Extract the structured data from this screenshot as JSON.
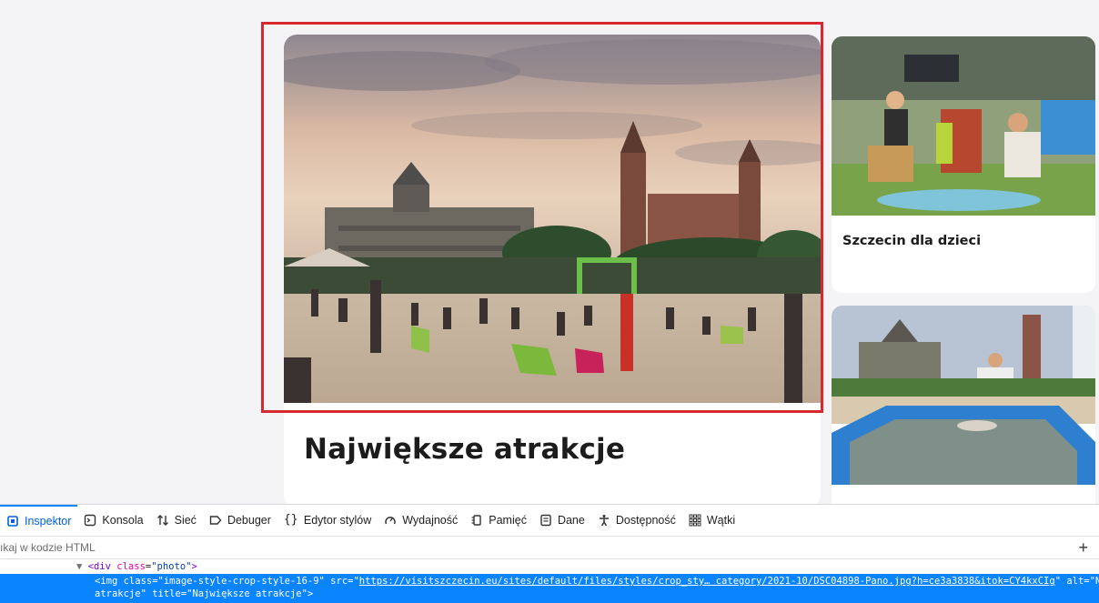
{
  "main_card": {
    "title": "Największe atrakcje",
    "photo_alt": "Największe atrakcje"
  },
  "side_cards": [
    {
      "title": "Szczecin dla dzieci"
    },
    {
      "title": ""
    }
  ],
  "devtools": {
    "tabs": [
      {
        "label": "Inspektor",
        "icon": "inspector-icon",
        "active": true
      },
      {
        "label": "Konsola",
        "icon": "console-icon"
      },
      {
        "label": "Sieć",
        "icon": "network-icon"
      },
      {
        "label": "Debuger",
        "icon": "debugger-icon"
      },
      {
        "label": "Edytor stylów",
        "icon": "style-editor-icon"
      },
      {
        "label": "Wydajność",
        "icon": "performance-icon"
      },
      {
        "label": "Pamięć",
        "icon": "memory-icon"
      },
      {
        "label": "Dane",
        "icon": "storage-icon"
      },
      {
        "label": "Dostępność",
        "icon": "accessibility-icon"
      },
      {
        "label": "Wątki",
        "icon": "threads-icon"
      }
    ],
    "search_placeholder": "ıkaj w kodzie HTML",
    "add_button": "+",
    "tree": {
      "open_tag": "<div",
      "attr_name": "class",
      "attr_value": "\"photo\"",
      "close": ">",
      "arrow": "▼",
      "img_line1_a": "<img class=\"image-style-crop-style-16-9\" src=\"",
      "img_url": "https://visitszczecin.eu/sites/default/files/styles/crop_sty… category/2021-10/DSC04898-Pano.jpg?h=ce3a3838&itok=CY4kxCIg",
      "img_line1_b": "\" alt=\"Największe",
      "img_line2": "atrakcje\" title=\"Największe atrakcje\">"
    }
  },
  "colors": {
    "highlight": "#d7282f",
    "devtools_accent": "#0a84ff",
    "selected_row": "#0a84ff"
  }
}
